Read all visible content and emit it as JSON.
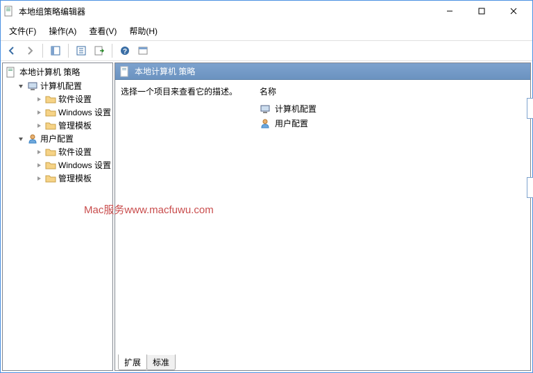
{
  "window": {
    "title": "本地组策略编辑器"
  },
  "menu": {
    "file": "文件(F)",
    "action": "操作(A)",
    "view": "查看(V)",
    "help": "帮助(H)"
  },
  "tree": {
    "root": "本地计算机 策略",
    "nodes": [
      {
        "label": "计算机配置"
      },
      {
        "label": "软件设置"
      },
      {
        "label": "Windows 设置"
      },
      {
        "label": "管理模板"
      },
      {
        "label": "用户配置"
      },
      {
        "label": "软件设置"
      },
      {
        "label": "Windows 设置"
      },
      {
        "label": "管理模板"
      }
    ]
  },
  "content": {
    "header": "本地计算机 策略",
    "description": "选择一个项目来查看它的描述。",
    "column": "名称",
    "items": [
      {
        "label": "计算机配置"
      },
      {
        "label": "用户配置"
      }
    ]
  },
  "tabs": {
    "extended": "扩展",
    "standard": "标准"
  },
  "watermark": "Mac服务www.macfuwu.com"
}
